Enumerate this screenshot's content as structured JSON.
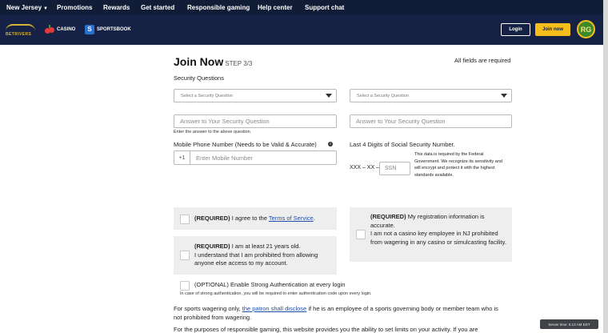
{
  "topnav": {
    "state": "New Jersey",
    "items": [
      "Promotions",
      "Rewards",
      "Get started",
      "Responsible gaming",
      "Help center",
      "Support chat"
    ]
  },
  "brand": {
    "logo_text": "BETRIVERS",
    "casino_label": "CASINO",
    "sportsbook_label": "SPORTSBOOK",
    "login_label": "Login",
    "join_label": "Join now",
    "rg_badge": "RG"
  },
  "form": {
    "title": "Join Now",
    "step": "STEP 3/3",
    "all_required": "All fields are required",
    "security_heading": "Security Questions",
    "q1_placeholder": "Select a Security Question",
    "q2_placeholder": "Select a Security Question",
    "a1_placeholder": "Answer to Your Security Question",
    "a2_placeholder": "Answer to Your Security Question",
    "answer_hint": "Enter the answer to the above question.",
    "phone_label": "Mobile Phone Number (Needs to be Valid & Accurate)",
    "phone_prefix": "+1",
    "phone_placeholder": "Enter Mobile Number",
    "ssn_label": "Last 4 Digits of Social Security Number.",
    "ssn_note": "This data is required by the Federal Government. We recognize its sensitivity and will encrypt and protect it with the highest standards available.",
    "ssn_prefix": "XXX – XX –",
    "ssn_placeholder": "SSN"
  },
  "consents": {
    "terms_req": "(REQUIRED)",
    "terms_text": "I agree to the",
    "terms_link": "Terms of Service",
    "terms_end": ".",
    "accuracy_req": "(REQUIRED)",
    "accuracy_line1": "My registration information is",
    "accuracy_line2": "accurate.",
    "accuracy_rest": "I am not a casino key employee in NJ prohibited from wagering in any casino or simulcasting facility.",
    "age_req": "(REQUIRED)",
    "age_line1": "I am at least 21 years old.",
    "age_rest": "I understand that I am prohibited from allowing anyone else access to my account.",
    "twofa_text": "(OPTIONAL) Enable Strong Authentication at every login",
    "twofa_note": "In case of strong authentication, you will be required to enter authentication code upon every login."
  },
  "footer": {
    "sports_intro": "For sports wagering only,",
    "patron_link": "the patron shall disclose",
    "sports_rest": "if he is an employee of a sports governing body or member team who is",
    "sports_line2": "not prohibited from wagering.",
    "purposes": "For the purposes of responsible gaming, this website provides you the ability to set limits on your activity. If you are"
  },
  "server_time": "Server time: 5:13 AM EDT"
}
